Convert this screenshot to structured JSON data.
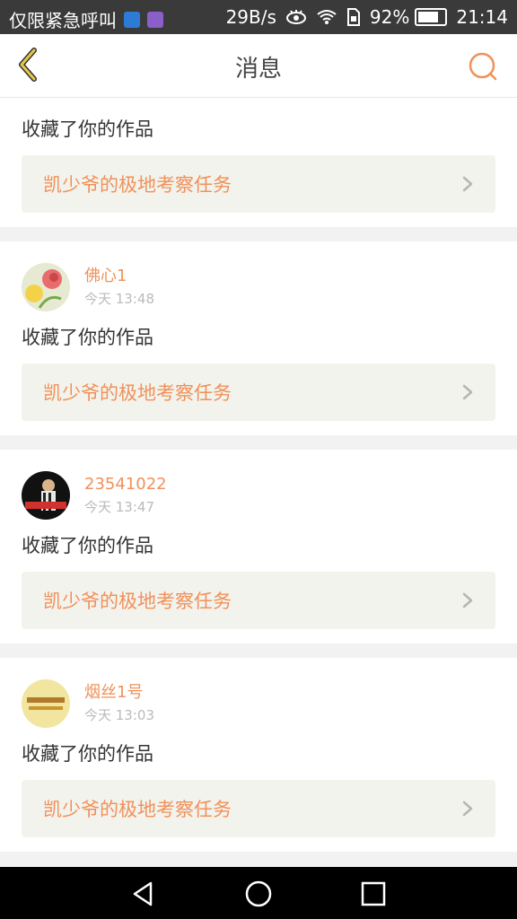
{
  "status_bar": {
    "carrier": "仅限紧急呼叫",
    "speed": "29B/s",
    "battery": "92%",
    "battery_level": 0.92,
    "time": "21:14",
    "icons": [
      "signal-app-icon",
      "gallery-app-icon",
      "eye-icon",
      "wifi-icon",
      "sim-icon",
      "battery-icon"
    ]
  },
  "header": {
    "title": "消息",
    "back_icon": "chevron-left-icon",
    "search_icon": "search-icon",
    "accent": "#f0915a",
    "back_color": "#e8c84a"
  },
  "messages": [
    {
      "user": "",
      "time": "",
      "action": "收藏了你的作品",
      "work": "凯少爷的极地考察任务"
    },
    {
      "user": "佛心1",
      "time": "今天 13:48",
      "action": "收藏了你的作品",
      "work": "凯少爷的极地考察任务"
    },
    {
      "user": "23541022",
      "time": "今天 13:47",
      "action": "收藏了你的作品",
      "work": "凯少爷的极地考察任务"
    },
    {
      "user": "烟丝1号",
      "time": "今天 13:03",
      "action": "收藏了你的作品",
      "work": "凯少爷的极地考察任务"
    }
  ],
  "nav_bar": {
    "icons": [
      "back-triangle-icon",
      "home-circle-icon",
      "recents-square-icon"
    ]
  }
}
